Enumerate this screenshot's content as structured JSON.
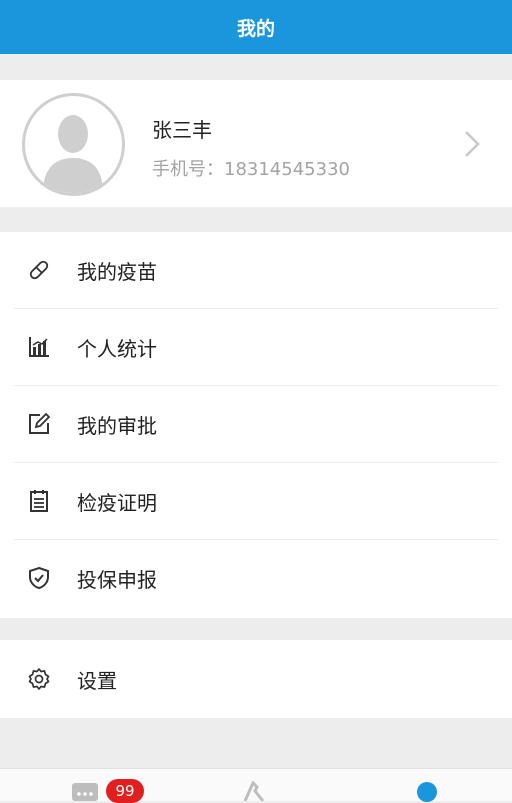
{
  "header": {
    "title": "我的"
  },
  "profile": {
    "name": "张三丰",
    "phone": "手机号：18314545330"
  },
  "menu": [
    {
      "label": "我的疫苗",
      "icon": "pill-icon"
    },
    {
      "label": "个人统计",
      "icon": "chart-icon"
    },
    {
      "label": "我的审批",
      "icon": "edit-icon"
    },
    {
      "label": "检疫证明",
      "icon": "document-icon"
    },
    {
      "label": "投保申报",
      "icon": "shield-icon"
    }
  ],
  "settings": {
    "label": "设置",
    "icon": "gear-icon"
  },
  "tabbar": {
    "badge": "99",
    "active_color": "#1a96dc"
  },
  "colors": {
    "header_bg": "#1a96dc",
    "badge_bg": "#e21f1f"
  }
}
